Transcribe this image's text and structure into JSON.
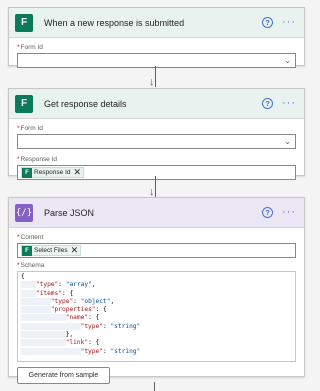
{
  "cards": [
    {
      "title": "When a new response is submitted",
      "app_icon": "forms-icon",
      "fields": [
        {
          "label": "Form Id",
          "required": true,
          "type": "dropdown",
          "value": ""
        }
      ]
    },
    {
      "title": "Get response details",
      "app_icon": "forms-icon",
      "fields": [
        {
          "label": "Form Id",
          "required": true,
          "type": "dropdown",
          "value": ""
        },
        {
          "label": "Response Id",
          "required": true,
          "type": "token",
          "token": "Response Id"
        }
      ]
    },
    {
      "title": "Parse JSON",
      "app_icon": "json-icon",
      "fields": [
        {
          "label": "Content",
          "required": true,
          "type": "token",
          "token": "Select Files"
        },
        {
          "label": "Schema",
          "required": true,
          "type": "code"
        }
      ],
      "button": "Generate from sample"
    }
  ],
  "schema_lines": [
    "{",
    "    \"type\": \"array\",",
    "    \"items\": {",
    "        \"type\": \"object\",",
    "        \"properties\": {",
    "            \"name\": {",
    "                \"type\": \"string\"",
    "            },",
    "            \"link\": {",
    "                \"type\": \"string\""
  ],
  "icons": {
    "help": "help-icon",
    "more": "more-icon",
    "chevron": "chevron-down-icon",
    "remove": "close-icon",
    "arrow": "arrow-down-icon"
  },
  "colors": {
    "forms_header": "#e8f2ee",
    "json_header": "#ece7f5",
    "forms_brand": "#0b7a5a",
    "json_brand": "#8661c5",
    "action_blue": "#4a6ecf",
    "required": "#a4262c"
  }
}
